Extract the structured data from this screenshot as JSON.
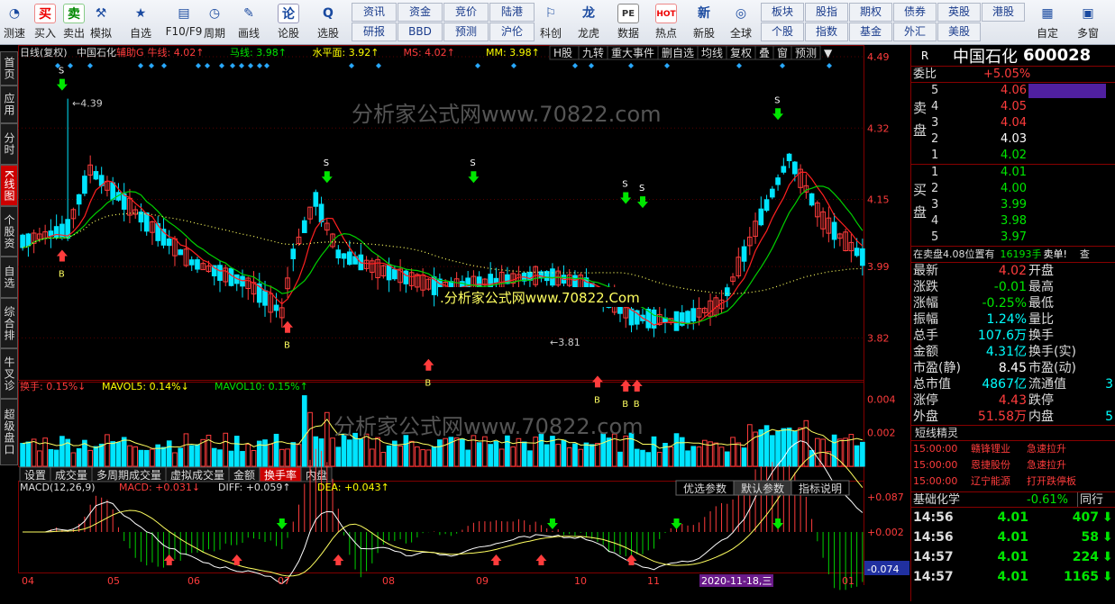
{
  "toolbar": {
    "left": [
      {
        "name": "refresh",
        "label": "测速",
        "icon": "clock"
      },
      {
        "name": "buy",
        "label": "买入",
        "icon": "买"
      },
      {
        "name": "sell",
        "label": "卖出",
        "icon": "卖"
      },
      {
        "name": "sim",
        "label": "模拟",
        "icon": "hammer"
      },
      {
        "name": "watch",
        "label": "自选",
        "icon": "star"
      },
      {
        "name": "f10",
        "label": "F10/F9",
        "icon": "doc"
      },
      {
        "name": "period",
        "label": "周期",
        "icon": "clock2"
      },
      {
        "name": "draw",
        "label": "画线",
        "icon": "pen"
      },
      {
        "name": "stock",
        "label": "论股",
        "icon": "论"
      },
      {
        "name": "select",
        "label": "选股",
        "icon": "q"
      }
    ],
    "grid1": [
      "资讯",
      "资金",
      "竞价",
      "陆港",
      "研报",
      "BBD",
      "预测",
      "沪伦"
    ],
    "mid": [
      {
        "name": "tech",
        "label": "科创",
        "icon": "chart"
      },
      {
        "name": "dragon",
        "label": "龙虎",
        "icon": "dragon"
      },
      {
        "name": "data",
        "label": "数据",
        "icon": "PE"
      },
      {
        "name": "hot",
        "label": "热点",
        "icon": "HOT"
      },
      {
        "name": "ipo",
        "label": "新股",
        "icon": "new"
      }
    ],
    "globe": "全球",
    "grid2": [
      "板块",
      "股指",
      "期权",
      "债券",
      "英股",
      "港股",
      "个股",
      "指数",
      "基金",
      "外汇",
      "美股"
    ],
    "right": [
      {
        "name": "custom",
        "label": "自定",
        "icon": "sheet"
      },
      {
        "name": "multi",
        "label": "多窗",
        "icon": "grid"
      }
    ]
  },
  "sidebar": [
    "首页",
    "应用",
    "分时图",
    "K线图",
    "个股资料",
    "自选股",
    "综合排名",
    "牛叉诊股",
    "超级盘口"
  ],
  "sidebar_active": 3,
  "kline": {
    "header": [
      {
        "t": "日线(复权)",
        "c": "wht"
      },
      {
        "t": "中国石化",
        "c": "wht"
      },
      {
        "t": "辅助G",
        "c": "red"
      },
      {
        "t": "牛线: 4.02↑",
        "c": "red"
      },
      {
        "t": "马线: 3.98↑",
        "c": "grn"
      },
      {
        "t": "水平面: 3.92↑",
        "c": "yel"
      },
      {
        "t": "MS: 4.02↑",
        "c": "red"
      },
      {
        "t": "MM: 3.98↑",
        "c": "yel"
      }
    ],
    "tabs": [
      "H股",
      "九转",
      "重大事件",
      "删自选",
      "均线",
      "复权",
      "叠",
      "窗",
      "预测"
    ],
    "yticks": [
      "4.49",
      "4.32",
      "4.15",
      "3.99",
      "3.82"
    ],
    "hi_label": "4.39",
    "lo_label": "3.81",
    "watermark": "分析家公式网www.70822.com",
    "watermark2": ".分析家公式网www.70822.Com"
  },
  "vol": {
    "header": [
      {
        "t": "换手: 0.15%↓",
        "c": "red"
      },
      {
        "t": "MAVOL5: 0.14%↓",
        "c": "yel"
      },
      {
        "t": "MAVOL10: 0.15%↑",
        "c": "grn"
      }
    ],
    "yticks": [
      "0.004",
      "0.002"
    ],
    "tabs": [
      "设置",
      "成交量",
      "多周期成交量",
      "虚拟成交量",
      "金额",
      "换手率",
      "内盘"
    ],
    "active_tab": 5
  },
  "macd": {
    "header": [
      {
        "t": "MACD(12,26,9)",
        "c": "wht"
      },
      {
        "t": "MACD: +0.031↓",
        "c": "red"
      },
      {
        "t": "DIFF: +0.059↑",
        "c": "wht"
      },
      {
        "t": "DEA: +0.043↑",
        "c": "yel"
      }
    ],
    "buttons": [
      "优选参数",
      "默认参数",
      "指标说明"
    ],
    "active_button": 1,
    "yticks": [
      "+0.087",
      "+0.002"
    ],
    "current_label": "-0.074"
  },
  "xaxis": {
    "months": [
      "04",
      "05",
      "06",
      "07",
      "08",
      "09",
      "10",
      "11",
      "01"
    ],
    "cursor_date": "2020-11-18,三"
  },
  "quote": {
    "marker": "R",
    "name": "中国石化",
    "code": "600028",
    "weibi_label": "委比",
    "weibi": "+5.05%",
    "sell_label": "卖盘",
    "buy_label": "买盘",
    "sells": [
      {
        "n": "5",
        "p": "4.06"
      },
      {
        "n": "4",
        "p": "4.05"
      },
      {
        "n": "3",
        "p": "4.04"
      },
      {
        "n": "2",
        "p": "4.03"
      },
      {
        "n": "1",
        "p": "4.02"
      }
    ],
    "buys": [
      {
        "n": "1",
        "p": "4.01"
      },
      {
        "n": "2",
        "p": "4.00"
      },
      {
        "n": "3",
        "p": "3.99"
      },
      {
        "n": "4",
        "p": "3.98"
      },
      {
        "n": "5",
        "p": "3.97"
      }
    ],
    "notice": "在卖盘4.08位置有",
    "notice_amt": "16193手",
    "notice_tail": "卖单!",
    "notice_end": "查",
    "stats": [
      {
        "l": "最新",
        "v": "4.02",
        "vc": "red",
        "r": "开盘"
      },
      {
        "l": "涨跌",
        "v": "-0.01",
        "vc": "grn",
        "r": "最高"
      },
      {
        "l": "涨幅",
        "v": "-0.25%",
        "vc": "grn",
        "r": "最低"
      },
      {
        "l": "振幅",
        "v": "1.24%",
        "vc": "cy",
        "r": "量比"
      },
      {
        "l": "总手",
        "v": "107.6万",
        "vc": "cy",
        "r": "换手"
      },
      {
        "l": "金额",
        "v": "4.31亿",
        "vc": "cy",
        "r": "换手(实)"
      },
      {
        "l": "市盈(静)",
        "v": "8.45",
        "vc": "wht",
        "r": "市盈(动)"
      },
      {
        "l": "总市值",
        "v": "4867亿",
        "vc": "cy",
        "r": "流通值",
        "rv": "3"
      },
      {
        "l": "涨停",
        "v": "4.43",
        "vc": "red",
        "r": "跌停"
      },
      {
        "l": "外盘",
        "v": "51.58万",
        "vc": "red",
        "r": "内盘",
        "rv": "5"
      }
    ],
    "elf_title": "短线精灵",
    "elf": [
      {
        "t": "15:00:00",
        "s": "赣锋锂业",
        "e": "急速拉升"
      },
      {
        "t": "15:00:00",
        "s": "恩捷股份",
        "e": "急速拉升"
      },
      {
        "t": "15:00:00",
        "s": "辽宁能源",
        "e": "打开跌停板"
      }
    ],
    "sector": "基础化学",
    "sector_chg": "-0.61%",
    "sector_tab": "同行",
    "ticks": [
      {
        "t": "14:56",
        "p": "4.01",
        "v": "407"
      },
      {
        "t": "14:56",
        "p": "4.01",
        "v": "58"
      },
      {
        "t": "14:57",
        "p": "4.01",
        "v": "224"
      },
      {
        "t": "14:57",
        "p": "4.01",
        "v": "1165"
      }
    ]
  },
  "colors": {
    "up": "#ff3c3c",
    "down": "#00e5ff",
    "ma1": "#ff2020",
    "ma2": "#00d000",
    "ma3": "#ffff60",
    "grid": "#800000"
  }
}
